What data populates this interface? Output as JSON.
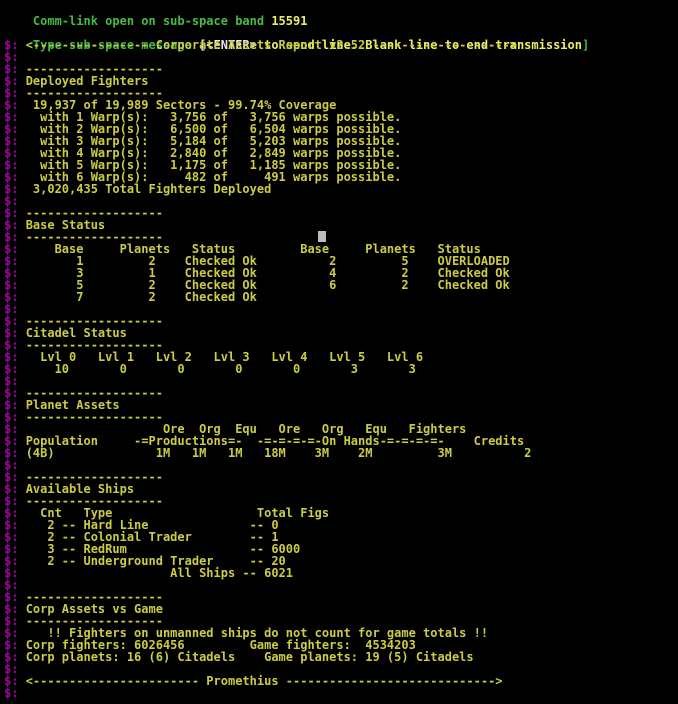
{
  "header": {
    "comm_link_prefix": "Comm-link open on sub-space band ",
    "band": "15591",
    "prompt_pre": "Type sub-space message ",
    "prompt_enter": "[<ENTER>",
    "prompt_post": " to send line. Blank line to end transmission",
    "prompt_close": "]"
  },
  "colors": {
    "prompt_prefix": "#AA00AA",
    "report_text": "#CCCC44",
    "header_green": "#44BB44",
    "header_yellow": "#EEEE66",
    "cursor": "#BBBBBB",
    "background": "#000000"
  },
  "prefix": "$: ",
  "lines": [
    "<---------------- Corporate Assets Report v2.52 ------------------->",
    "",
    "-------------------",
    "Deployed Fighters",
    "-------------------",
    " 19,937 of 19,989 Sectors - 99.74% Coverage",
    "  with 1 Warp(s):   3,756 of   3,756 warps possible.",
    "  with 2 Warp(s):   6,500 of   6,504 warps possible.",
    "  with 3 Warp(s):   5,184 of   5,203 warps possible.",
    "  with 4 Warp(s):   2,840 of   2,849 warps possible.",
    "  with 5 Warp(s):   1,175 of   1,185 warps possible.",
    "  with 6 Warp(s):     482 of     491 warps possible.",
    " 3,020,435 Total Fighters Deployed",
    "",
    "-------------------",
    "Base Status",
    "-------------------",
    "    Base     Planets   Status         Base     Planets   Status",
    "       1         2    Checked Ok          2         5    OVERLOADED",
    "       3         1    Checked Ok          4         2    Checked Ok",
    "       5         2    Checked Ok          6         2    Checked Ok",
    "       7         2    Checked Ok",
    "",
    "-------------------",
    "Citadel Status",
    "-------------------",
    "  Lvl 0   Lvl 1   Lvl 2   Lvl 3   Lvl 4   Lvl 5   Lvl 6",
    "    10       0       0       0       0       3       3",
    "",
    "-------------------",
    "Planet Assets",
    "-------------------",
    "                   Ore  Org  Equ   Ore   Org   Equ   Fighters",
    "Population     -=Productions=-  -=-=-=-=-On Hands-=-=-=-=-    Credits",
    "(4B)              1M   1M   1M   18M    3M    2M         3M          2",
    "",
    "-------------------",
    "Available Ships",
    "-------------------",
    "  Cnt   Type                    Total Figs",
    "   2 -- Hard Line              -- 0",
    "   2 -- Colonial Trader        -- 1",
    "   3 -- RedRum                 -- 6000",
    "   2 -- Underground Trader     -- 20",
    "                    All Ships -- 6021",
    "",
    "-------------------",
    "Corp Assets vs Game",
    "-------------------",
    "   !! Fighters on unmanned ships do not count for game totals !!",
    "Corp fighters: 6026456         Game fighters:  4534203",
    "Corp planets: 16 (6) Citadels    Game planets: 19 (5) Citadels",
    "",
    "<----------------------- Promethius ----------------------------->",
    ""
  ]
}
